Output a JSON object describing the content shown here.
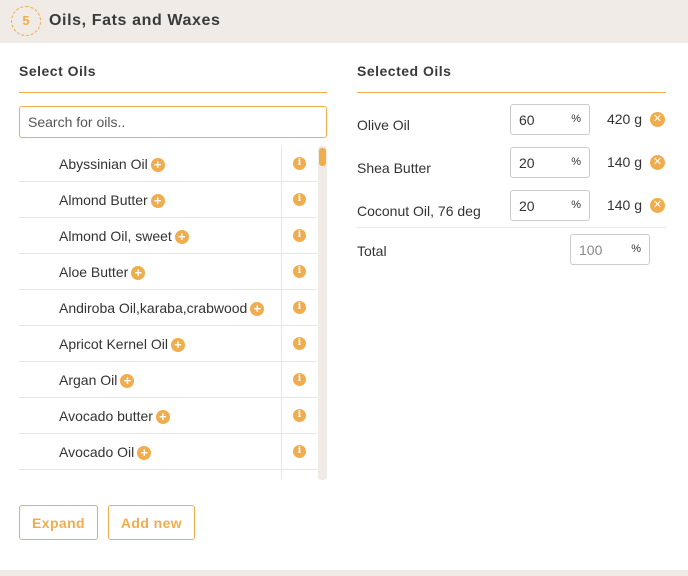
{
  "header": {
    "step": "5",
    "title": "Oils, Fats and Waxes"
  },
  "select_oils": {
    "title": "Select Oils",
    "search_placeholder": "Search for oils..",
    "items": [
      {
        "name": "Abyssinian Oil"
      },
      {
        "name": "Almond Butter"
      },
      {
        "name": "Almond Oil, sweet"
      },
      {
        "name": "Aloe Butter"
      },
      {
        "name": "Andiroba Oil,karaba,crabwood"
      },
      {
        "name": "Apricot Kernel Oil"
      },
      {
        "name": "Argan Oil"
      },
      {
        "name": "Avocado butter"
      },
      {
        "name": "Avocado Oil"
      },
      {
        "name": ""
      }
    ],
    "add_icon": "plus-circle-icon",
    "info_icon": "info-circle-icon"
  },
  "buttons": {
    "expand": "Expand",
    "add_new": "Add new"
  },
  "selected_oils": {
    "title": "Selected Oils",
    "percent_sign": "%",
    "items": [
      {
        "name": "Olive Oil",
        "percent": "60",
        "weight": "420 g"
      },
      {
        "name": "Shea Butter",
        "percent": "20",
        "weight": "140 g"
      },
      {
        "name": "Coconut Oil, 76 deg",
        "percent": "20",
        "weight": "140 g"
      }
    ],
    "remove_icon": "close-circle-icon",
    "total_label": "Total",
    "total_value": "100"
  },
  "colors": {
    "accent": "#f0ad4e",
    "header_bg": "#f0ebe6",
    "text": "#333333"
  }
}
